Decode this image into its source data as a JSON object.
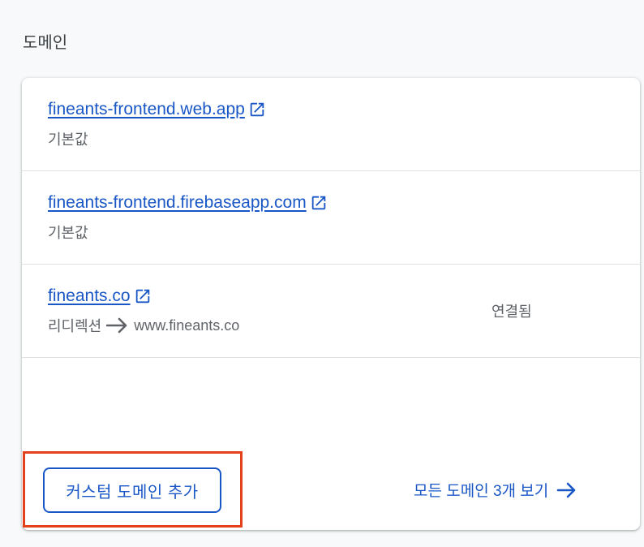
{
  "section": {
    "title": "도메인"
  },
  "domains": [
    {
      "name": "fineants-frontend.web.app",
      "subtitle": "기본값",
      "status": ""
    },
    {
      "name": "fineants-frontend.firebaseapp.com",
      "subtitle": "기본값",
      "status": ""
    },
    {
      "name": "fineants.co",
      "subtitle": "리디렉션",
      "redirect_target": "www.fineants.co",
      "status": "연결됨"
    }
  ],
  "actions": {
    "add_custom_domain": "커스텀 도메인 추가",
    "view_all_domains": "모든 도메인 3개 보기"
  },
  "icons": {
    "external_link": "external-link-icon",
    "redirect_arrow": "arrow-right-icon",
    "view_all_arrow": "arrow-right-icon"
  },
  "colors": {
    "link": "#1a57c6",
    "highlight_border": "#e3411c",
    "secondary_text": "#5f6368",
    "divider": "#e0e0e0",
    "page_background": "#f8f9fa",
    "card_background": "#ffffff"
  }
}
